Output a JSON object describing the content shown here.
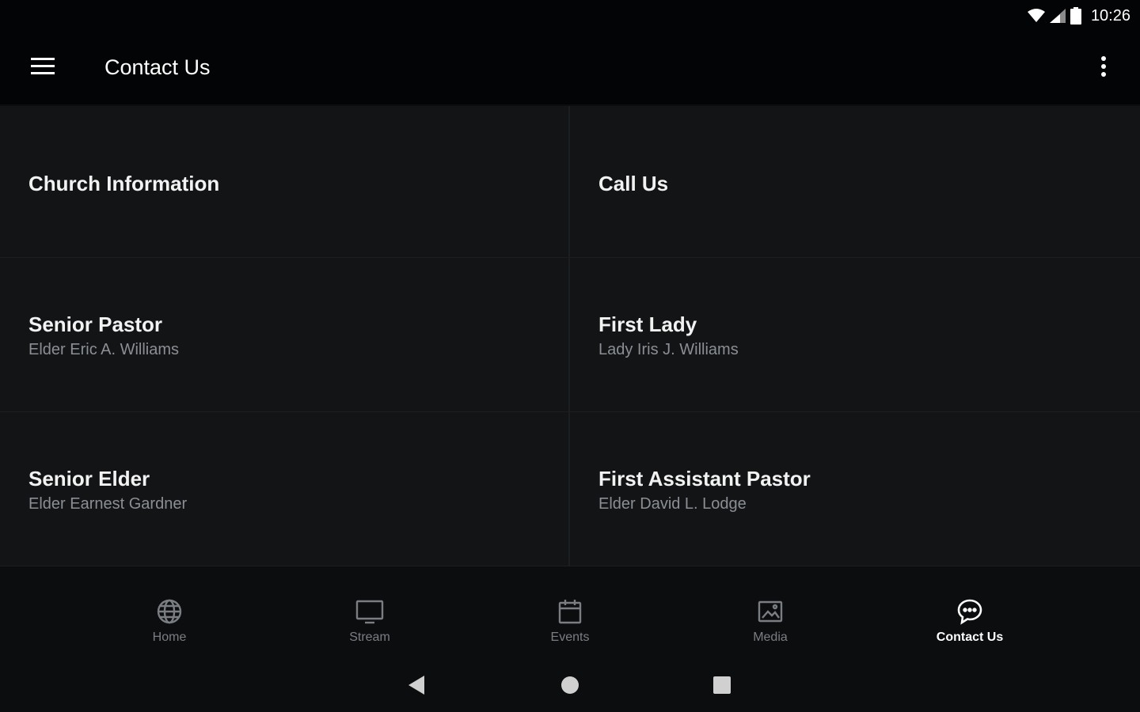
{
  "status_bar": {
    "time": "10:26"
  },
  "app_bar": {
    "title": "Contact Us"
  },
  "cells": [
    {
      "title": "Church Information",
      "subtitle": ""
    },
    {
      "title": "Call Us",
      "subtitle": ""
    },
    {
      "title": "Senior Pastor",
      "subtitle": "Elder Eric A. Williams"
    },
    {
      "title": "First Lady",
      "subtitle": "Lady Iris J. Williams"
    },
    {
      "title": "Senior Elder",
      "subtitle": "Elder Earnest Gardner"
    },
    {
      "title": "First Assistant Pastor",
      "subtitle": "Elder David L. Lodge"
    }
  ],
  "bottom_nav": [
    {
      "label": "Home",
      "icon": "globe-icon",
      "active": false
    },
    {
      "label": "Stream",
      "icon": "monitor-icon",
      "active": false
    },
    {
      "label": "Events",
      "icon": "calendar-icon",
      "active": false
    },
    {
      "label": "Media",
      "icon": "image-icon",
      "active": false
    },
    {
      "label": "Contact Us",
      "icon": "chat-bubble-icon",
      "active": true
    }
  ],
  "colors": {
    "background": "#0c0d0f",
    "bar": "#030405",
    "content": "#121416",
    "inactive": "#7a7e83",
    "active": "#ffffff"
  }
}
